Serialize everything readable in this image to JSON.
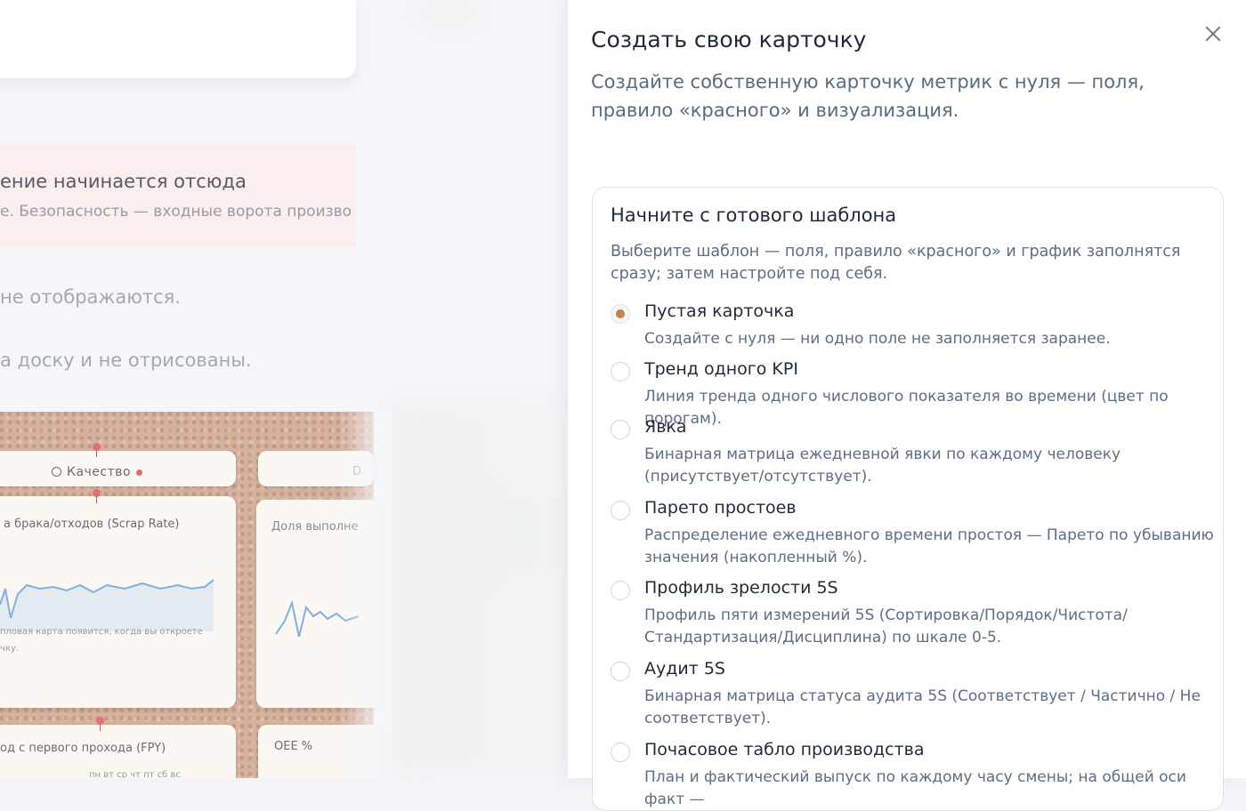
{
  "background": {
    "alert_title": "ение начинается отсюда",
    "alert_subtitle": "е. Безопасность — входные ворота произво",
    "note_1": "не отображаются.",
    "note_2": "а доску и не отрисованы.",
    "board": {
      "column_1_header": "Качество",
      "column_2_header": "D",
      "card_1_title": "а брака/отходов (Scrap Rate)",
      "card_1_hint_line1": "пловая карта появится, когда вы откроете",
      "card_1_hint_line2": "чку.",
      "card_2_title": "Доля выполне",
      "card_3_title": "од с первого прохода (FPY)",
      "card_4_title": "OEE %",
      "weekdays": "пн вт ср чт пт сб вс"
    }
  },
  "panel": {
    "title": "Создать свою карточку",
    "subtitle": "Создайте собственную карточку метрик с нуля — поля, правило «красного» и визуализация.",
    "templates": {
      "title": "Начните с готового шаблона",
      "description": "Выберите шаблон — поля, правило «красного» и график заполнятся сразу; затем настройте под себя.",
      "options": [
        {
          "name": "Пустая карточка",
          "description": "Создайте с нуля — ни одно поле не заполняется заранее.",
          "selected": true
        },
        {
          "name": "Тренд одного KPI",
          "description": "Линия тренда одного числового показателя во времени (цвет по порогам).",
          "selected": false
        },
        {
          "name": "Явка",
          "description": "Бинарная матрица ежедневной явки по каждому человеку (присутствует/отсутствует).",
          "selected": false
        },
        {
          "name": "Парето простоев",
          "description": "Распределение ежедневного времени простоя — Парето по убыванию значения (накопленный %).",
          "selected": false
        },
        {
          "name": "Профиль зрелости 5S",
          "description": "Профиль пяти измерений 5S (Сортировка/Порядок/Чистота/Стандартизация/Дисциплина) по шкале 0-5.",
          "selected": false
        },
        {
          "name": "Аудит 5S",
          "description": "Бинарная матрица статуса аудита 5S (Соответствует / Частично / Не соответствует).",
          "selected": false
        },
        {
          "name": "Почасовое табло производства",
          "description": "План и фактический выпуск по каждому часу смены; на общей оси факт —",
          "selected": false
        }
      ]
    }
  },
  "colors": {
    "accent": "#d9803f",
    "title_text": "#1f2a3a",
    "muted_text": "#5e6e84",
    "chart_line": "#7fb0e0"
  },
  "icons": {
    "close": "close-icon",
    "search": "search-icon"
  }
}
